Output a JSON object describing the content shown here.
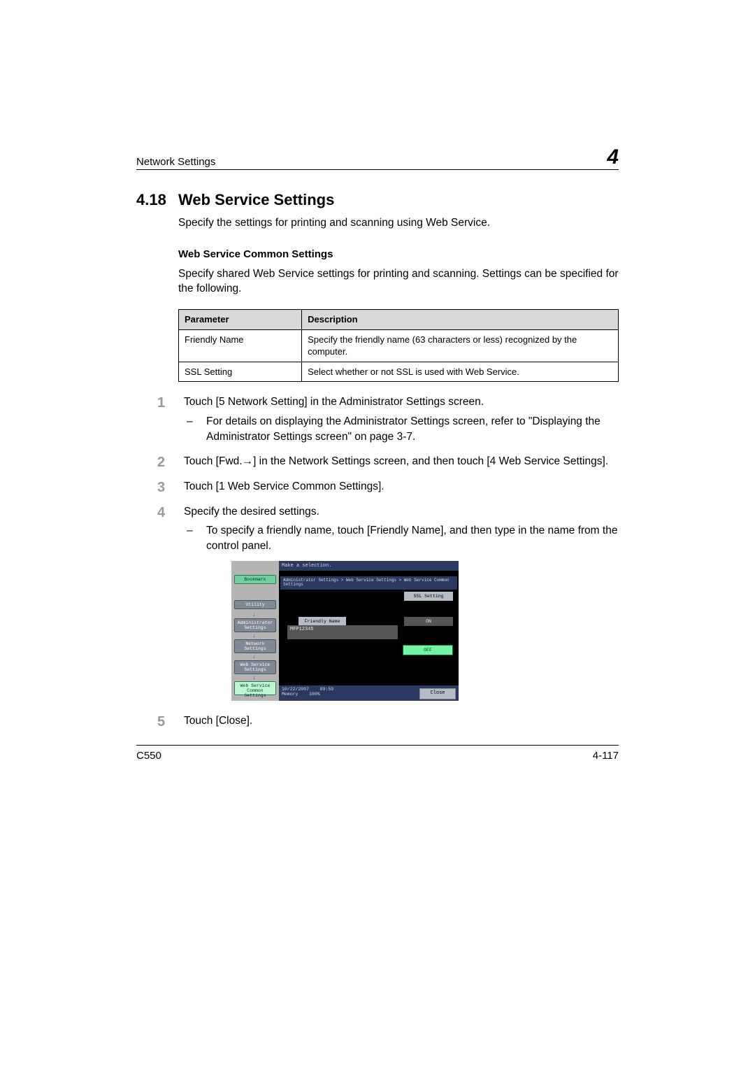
{
  "header": {
    "left": "Network Settings",
    "chapter": "4"
  },
  "section": {
    "number": "4.18",
    "title": "Web Service Settings",
    "intro": "Specify the settings for printing and scanning using Web Service."
  },
  "subheading": "Web Service Common Settings",
  "subintro": "Specify shared Web Service settings for printing and scanning. Settings can be specified for the following.",
  "table": {
    "head_param": "Parameter",
    "head_desc": "Description",
    "rows": [
      {
        "param": "Friendly Name",
        "desc": "Specify the friendly name (63 characters or less) recognized by the computer."
      },
      {
        "param": "SSL Setting",
        "desc": "Select whether or not SSL is used with Web Service."
      }
    ]
  },
  "steps": {
    "s1": "Touch [5 Network Setting] in the Administrator Settings screen.",
    "s1_sub1": "For details on displaying the Administrator Settings screen, refer to \"Displaying the Administrator Settings screen\" on page 3-7.",
    "s2": "Touch [Fwd.→] in the Network Settings screen, and then touch [4 Web Service Settings].",
    "s3": "Touch [1 Web Service Common Settings].",
    "s4": "Specify the desired settings.",
    "s4_sub1": "To specify a friendly name, touch [Friendly Name], and then type in the name from the control panel.",
    "s5": "Touch [Close]."
  },
  "screenshot": {
    "titlebar": "Make a selection.",
    "breadcrumb": "Administrator Settings > Web Service Settings > Web Service Common Settings",
    "sidebar": {
      "bookmark": "Bookmark",
      "utility": "Utility",
      "admin": "Administrator\nSettings",
      "network": "Network\nSettings",
      "websvc": "Web Service\nSettings",
      "common": "Web Service\nCommon Settings"
    },
    "ssl_heading": "SSL Setting",
    "friendly_btn": "Friendly Name",
    "friendly_val": "MFP12345",
    "on": "ON",
    "off": "OFF",
    "close": "Close",
    "status_date": "10/22/2007",
    "status_time": "09:59",
    "status_mem_label": "Memory",
    "status_mem_val": "100%"
  },
  "footer": {
    "model": "C550",
    "page": "4-117"
  }
}
